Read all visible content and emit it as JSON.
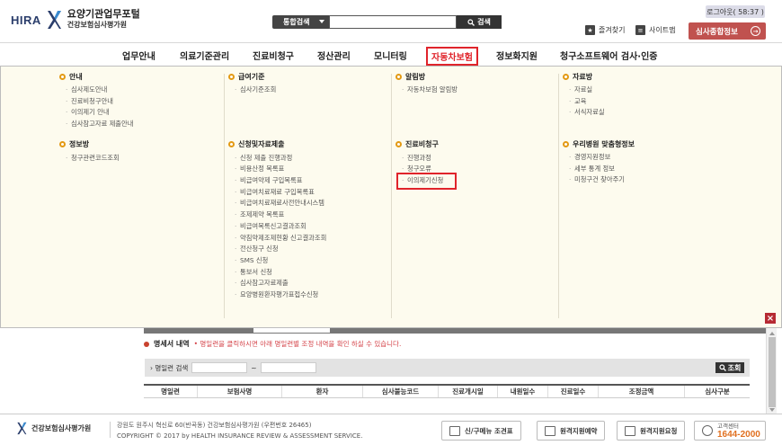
{
  "header": {
    "brand": "HIRA",
    "portal_title": "요양기관업무포털",
    "org_name": "건강보험심사평가원",
    "search": {
      "scope": "통합검색",
      "placeholder": "",
      "button_label": "검색"
    },
    "login_timer": "로그아웃( 58:37 )",
    "favorites_label": "즐겨찾기",
    "sitemap_label": "사이트맵",
    "service_button": "심사종합정보"
  },
  "gnb": {
    "items": [
      {
        "label": "업무안내"
      },
      {
        "label": "의료기준관리"
      },
      {
        "label": "진료비청구"
      },
      {
        "label": "정산관리"
      },
      {
        "label": "모니터링"
      },
      {
        "label": "자동차보험"
      },
      {
        "label": "정보화지원"
      },
      {
        "label": "청구소프트웨어 검사·인증"
      }
    ],
    "active_index": 5
  },
  "mega_menu": {
    "columns": [
      {
        "sections": [
          {
            "title": "안내",
            "items": [
              "심사제도안내",
              "진료비청구안내",
              "이의제기 안내",
              "심사참고자료 제출안내"
            ]
          },
          {
            "title": "정보방",
            "items": [
              "청구관련코드조회"
            ]
          }
        ]
      },
      {
        "sections": [
          {
            "title": "급여기준",
            "items": [
              "심사기준조회"
            ]
          },
          {
            "title": "신청및자료제출",
            "items": [
              "신청 제출 진행과정",
              "비용산정 목록표",
              "비급여약제 구입목록표",
              "비급여치료재료 구입목록표",
              "비급여치료재료사전안내시스템",
              "조제제약 목록표",
              "비급여목록신고결과조회",
              "약침약제조제현황 신고결과조회",
              "전산청구 신청",
              "SMS 신청",
              "통보서 신청",
              "심사참고자료제출",
              "요양병원환자평가표접수신청"
            ]
          }
        ]
      },
      {
        "sections": [
          {
            "title": "알림방",
            "items": [
              "자동차보험 알림방"
            ]
          },
          {
            "title": "진료비청구",
            "items": [
              "진행과정",
              "청구오류",
              "이의제기신청"
            ]
          }
        ]
      },
      {
        "sections": [
          {
            "title": "자료방",
            "items": [
              "자료실",
              "교육",
              "서식자료실"
            ]
          },
          {
            "title": "우리병원 맞춤형정보",
            "items": [
              "경영지원정보",
              "세부 통계 정보",
              "미청구건 찾아주기"
            ]
          }
        ]
      }
    ],
    "highlighted_item": "이의제기신청",
    "close_label": "×"
  },
  "content": {
    "section_title": "명세서 내역",
    "notice": "• 명일련을 클릭하시면 아래 명일련별 조정 내역을 확인 하실 수 있습니다.",
    "filter_label": "› 명일련 검색",
    "range_sep": "~",
    "search_button": "조회",
    "table_headers": [
      "명일련",
      "보험사명",
      "환자",
      "심사불능코드",
      "진료개시일",
      "내원일수",
      "진료일수",
      "조정금액",
      "심사구분"
    ]
  },
  "footer": {
    "org_name": "건강보험심사평가원",
    "address": "강원도 원주시 혁신로 60(반곡동) 건강보험심사평가원 (우편번호 26465)",
    "copyright": "COPYRIGHT © 2017 by HEALTH INSURANCE REVIEW & ASSESSMENT SERVICE.",
    "buttons": [
      "신/구메뉴 조견표",
      "원격지원예약",
      "원격지원요청"
    ],
    "call_center_label": "고객센터",
    "call_center_number": "1644-2000"
  },
  "colors": {
    "accent_red": "#c0524f",
    "highlight_red": "#e0242b",
    "menu_bg": "#fdfbee",
    "bullet_orange": "#e39a14"
  }
}
